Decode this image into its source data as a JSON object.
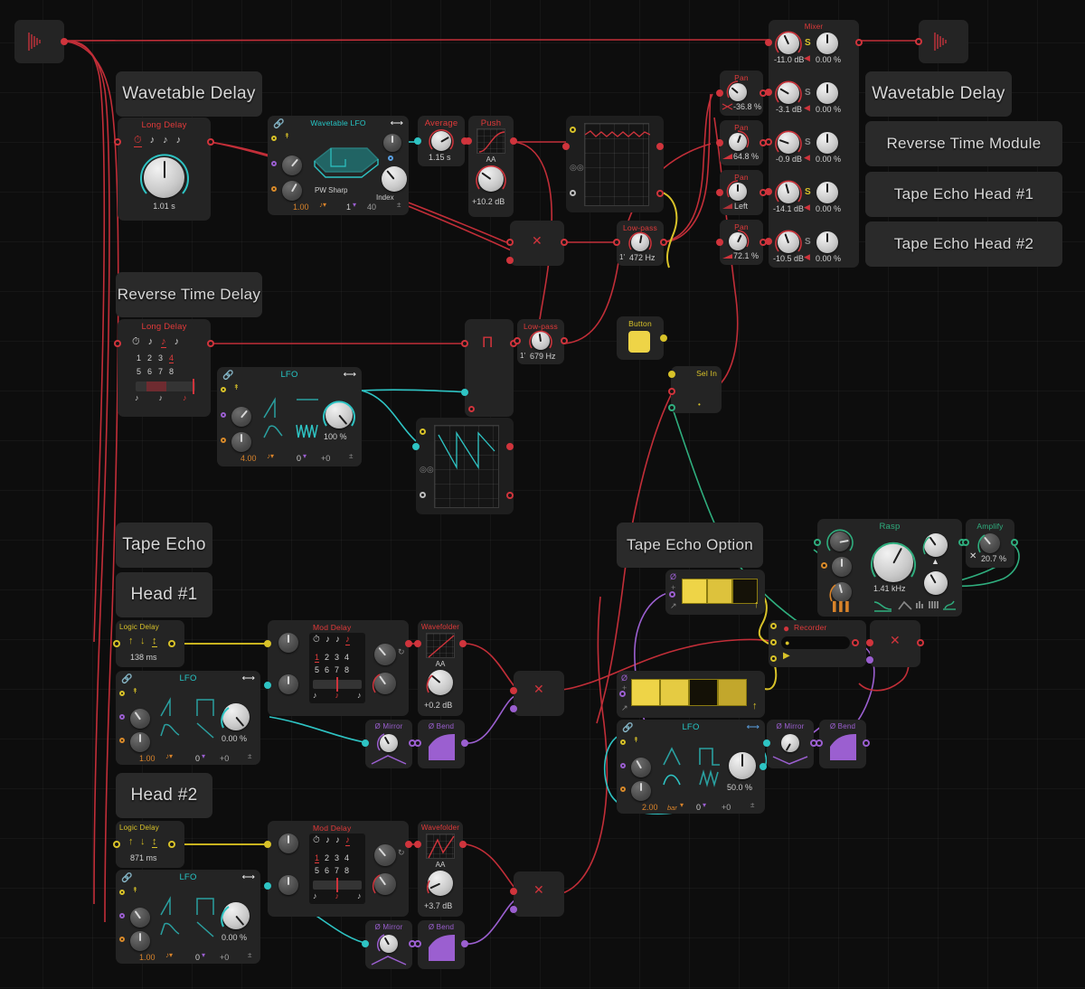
{
  "app": {
    "name": "Modular Patch Editor",
    "canvas_bg": "#0d0d0d",
    "grid_color": "#ffffff"
  },
  "colors": {
    "red": "#e03a3a",
    "cyan": "#26c6c6",
    "yellow": "#d8c229",
    "green": "#2fae7e",
    "purple": "#9b5fd0",
    "grey": "#8a8a8a",
    "white": "#d8d8d8"
  },
  "section_labels": [
    {
      "id": "wavetable-delay-left",
      "text": "Wavetable Delay"
    },
    {
      "id": "reverse-time-delay",
      "text": "Reverse Time Delay"
    },
    {
      "id": "tape-echo",
      "text": "Tape Echo"
    },
    {
      "id": "head-1",
      "text": "Head #1"
    },
    {
      "id": "head-2",
      "text": "Head #2"
    },
    {
      "id": "tape-echo-option",
      "text": "Tape Echo Option"
    },
    {
      "id": "wavetable-delay-right",
      "text": "Wavetable Delay"
    },
    {
      "id": "reverse-time-module",
      "text": "Reverse Time Module"
    },
    {
      "id": "tape-echo-head-1",
      "text": "Tape Echo Head #1"
    },
    {
      "id": "tape-echo-head-2",
      "text": "Tape Echo Head #2"
    }
  ],
  "modules": {
    "input_source": {
      "title": "",
      "icon": "waveform-decay-icon"
    },
    "output_sink": {
      "title": "",
      "icon": "waveform-decay-icon"
    },
    "long_delay_1": {
      "title": "Long Delay",
      "notes": [
        "clock-icon",
        "eighth-note",
        "eighth-note",
        "quarter-note"
      ],
      "selected_note_index": 0,
      "value": "1.01 s"
    },
    "wavetable_lfo": {
      "title": "Wavetable LFO",
      "wave_label": "PW Sharp",
      "index_label": "Index",
      "footer": {
        "rate": "1.00",
        "note": "quarter-note",
        "mult": "1",
        "phase": "40"
      },
      "link_icon": "link-icon",
      "bipolar_icon": "bipolar-arrow-icon"
    },
    "average": {
      "title": "Average",
      "value": "1.15 s"
    },
    "push": {
      "title": "Push",
      "aa_label": "AA",
      "value": "+10.2 dB"
    },
    "scope_top": {
      "title": "",
      "waveform": "ripple-red"
    },
    "multiply_1": {
      "title": "",
      "symbol": "multiply-icon"
    },
    "lowpass_1": {
      "title": "Low-pass",
      "octave": "1'",
      "value": "472 Hz"
    },
    "pan_1": {
      "title": "Pan",
      "value": "-36.8 %"
    },
    "pan_2": {
      "title": "Pan",
      "value": "64.8 %"
    },
    "pan_3": {
      "title": "Pan",
      "value": "Left"
    },
    "pan_4": {
      "title": "Pan",
      "value": "72.1 %"
    },
    "mixer": {
      "title": "Mixer",
      "channels": [
        {
          "gain": "-11.0 dB",
          "solo": "S",
          "solo_active": true,
          "mute_icon": "speaker-mute-icon",
          "pan": "0.00 %"
        },
        {
          "gain": "-3.1 dB",
          "solo": "S",
          "solo_active": false,
          "mute_icon": "speaker-mute-icon",
          "pan": "0.00 %"
        },
        {
          "gain": "-0.9 dB",
          "solo": "S",
          "solo_active": false,
          "mute_icon": "speaker-mute-icon",
          "pan": "0.00 %"
        },
        {
          "gain": "-14.1 dB",
          "solo": "S",
          "solo_active": true,
          "mute_icon": "speaker-mute-icon",
          "pan": "0.00 %"
        },
        {
          "gain": "-10.5 dB",
          "solo": "S",
          "solo_active": false,
          "mute_icon": "speaker-mute-icon",
          "pan": "0.00 %"
        }
      ]
    },
    "long_delay_2": {
      "title": "Long Delay",
      "notes": [
        "clock-icon",
        "eighth-note",
        "quarter-note",
        "quarter-note"
      ],
      "selected_note_index": 2,
      "numbers_row1": [
        "1",
        "2",
        "3",
        "4"
      ],
      "numbers_row2": [
        "5",
        "6",
        "7",
        "8"
      ],
      "selected_number": "4"
    },
    "lfo_reverse": {
      "title": "LFO",
      "value": "100 %",
      "footer": {
        "rate": "4.00",
        "note": "quarter-note",
        "phase": "0",
        "offset": "+0"
      }
    },
    "pi_module": {
      "title": "",
      "symbol": "pi-icon"
    },
    "lowpass_2": {
      "title": "Low-pass",
      "octave": "1'",
      "value": "679 Hz"
    },
    "button": {
      "title": "Button",
      "state": "on"
    },
    "sel_in": {
      "title": "Sel In"
    },
    "scope_saw": {
      "title": "",
      "waveform": "sawtooth-cyan"
    },
    "logic_delay_1": {
      "title": "Logic Delay",
      "value": "138 ms",
      "icons": [
        "arrow-up-icon",
        "arrow-down-icon",
        "arrow-updown-icon"
      ],
      "selected_icon": 2
    },
    "logic_delay_2": {
      "title": "Logic Delay",
      "value": "871 ms",
      "icons": [
        "arrow-up-icon",
        "arrow-down-icon",
        "arrow-updown-icon"
      ],
      "selected_icon": 2
    },
    "lfo_head1": {
      "title": "LFO",
      "value": "0.00 %",
      "footer": {
        "rate": "1.00",
        "note": "quarter-note",
        "phase": "0",
        "offset": "+0"
      }
    },
    "lfo_head2": {
      "title": "LFO",
      "value": "0.00 %",
      "footer": {
        "rate": "1.00",
        "note": "quarter-note",
        "phase": "0",
        "offset": "+0"
      }
    },
    "mod_delay_1": {
      "title": "Mod Delay",
      "notes": [
        "clock-icon",
        "eighth-note",
        "eighth-note",
        "quarter-note"
      ],
      "selected_note_index": 3,
      "numbers_row1": [
        "1",
        "2",
        "3",
        "4"
      ],
      "numbers_row2": [
        "5",
        "6",
        "7",
        "8"
      ],
      "selected_number": "1"
    },
    "mod_delay_2": {
      "title": "Mod Delay",
      "notes": [
        "clock-icon",
        "eighth-note",
        "eighth-note",
        "quarter-note"
      ],
      "selected_note_index": 3,
      "numbers_row1": [
        "1",
        "2",
        "3",
        "4"
      ],
      "numbers_row2": [
        "5",
        "6",
        "7",
        "8"
      ],
      "selected_number": "1"
    },
    "wavefolder_1": {
      "title": "Wavefolder",
      "aa_label": "AA",
      "value": "+0.2 dB"
    },
    "wavefolder_2": {
      "title": "Wavefolder",
      "aa_label": "AA",
      "value": "+3.7 dB"
    },
    "mirror_1": {
      "title": "Ø Mirror"
    },
    "bend_1": {
      "title": "Ø Bend"
    },
    "mirror_2": {
      "title": "Ø Mirror"
    },
    "bend_2": {
      "title": "Ø Bend"
    },
    "mirror_3": {
      "title": "Ø Mirror"
    },
    "bend_3": {
      "title": "Ø Bend"
    },
    "multiply_2": {
      "title": "",
      "symbol": "multiply-icon"
    },
    "multiply_3": {
      "title": "",
      "symbol": "multiply-icon"
    },
    "multiply_4": {
      "title": "",
      "symbol": "multiply-icon"
    },
    "sequencer_top": {
      "title": "",
      "steps": [
        {
          "color": "#eed447",
          "active": true
        },
        {
          "color": "#ddc23c",
          "active": true
        },
        {
          "color": "#151208",
          "active": false
        }
      ],
      "phase_icon": "phase-icon",
      "expand_icon": "expand-icon",
      "up_icon": "arrow-up-icon"
    },
    "sequencer_bottom": {
      "title": "",
      "steps": [
        {
          "color": "#eed447",
          "active": true
        },
        {
          "color": "#e5cb42",
          "active": true
        },
        {
          "color": "#141106",
          "active": false
        },
        {
          "color": "#c2a72c",
          "active": true
        }
      ],
      "phase_icon": "phase-icon",
      "expand_icon": "expand-icon",
      "up_icon": "arrow-up-icon"
    },
    "lfo_option": {
      "title": "LFO",
      "value": "50.0 %",
      "footer": {
        "rate": "2.00",
        "unit": "bar",
        "phase": "0",
        "offset": "+0"
      }
    },
    "rasp": {
      "title": "Rasp",
      "value": "1.41 kHz",
      "shape_icons": [
        "curve-fall-icon",
        "curve-peak-icon"
      ],
      "mode_icons": [
        "bars-icon",
        "comb-icon",
        "noise-icon"
      ],
      "selected_mode": 2
    },
    "amplify": {
      "title": "Amplify",
      "value": "20.7 %",
      "multiply_symbol": "×"
    },
    "recorder": {
      "title": "Recorder",
      "record_icon": "record-dot-icon",
      "play_icon": "play-icon",
      "progress": 0
    }
  }
}
